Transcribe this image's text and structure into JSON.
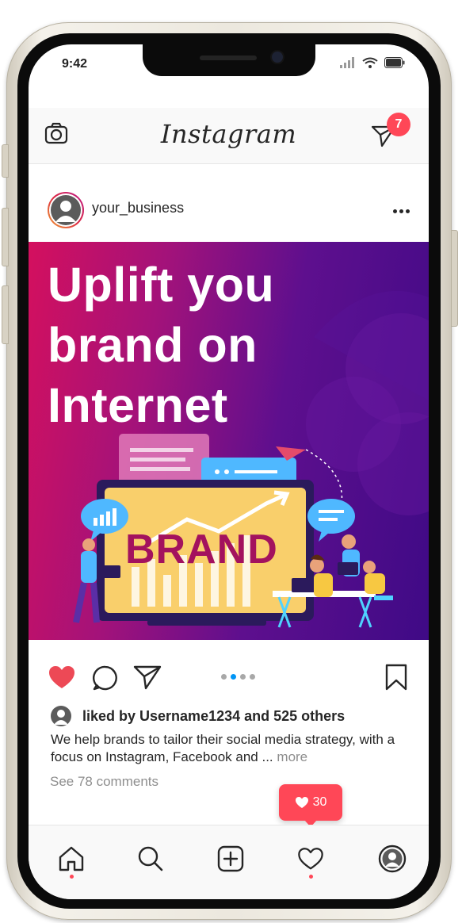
{
  "status_bar": {
    "time": "9:42"
  },
  "header": {
    "app_name": "Instagram",
    "notification_count": "7"
  },
  "post": {
    "username": "your_business",
    "headline_lines": [
      "Uplift you",
      "brand on",
      "Internet"
    ],
    "image_brand_text": "BRAND",
    "liked_by": "liked by Username1234 and 525 others",
    "caption": "We help brands to tailor their social media strategy, with a focus on Instagram, Facebook and ...",
    "caption_more": "more",
    "comments_link": "See 78 comments",
    "carousel": {
      "count": 4,
      "active_index": 1
    },
    "liked": true
  },
  "like_notification": {
    "count": "30"
  },
  "bottom_nav": {
    "items": [
      "home",
      "search",
      "create",
      "activity",
      "profile"
    ],
    "dots_on": [
      "home",
      "activity"
    ]
  },
  "colors": {
    "accent_red": "#ff4757",
    "heart_red": "#ed4956",
    "carousel_active": "#0095f6",
    "carousel_inactive": "#a8a8a8",
    "gradient_pink": "#d4105e",
    "gradient_purple": "#3f0a86"
  }
}
